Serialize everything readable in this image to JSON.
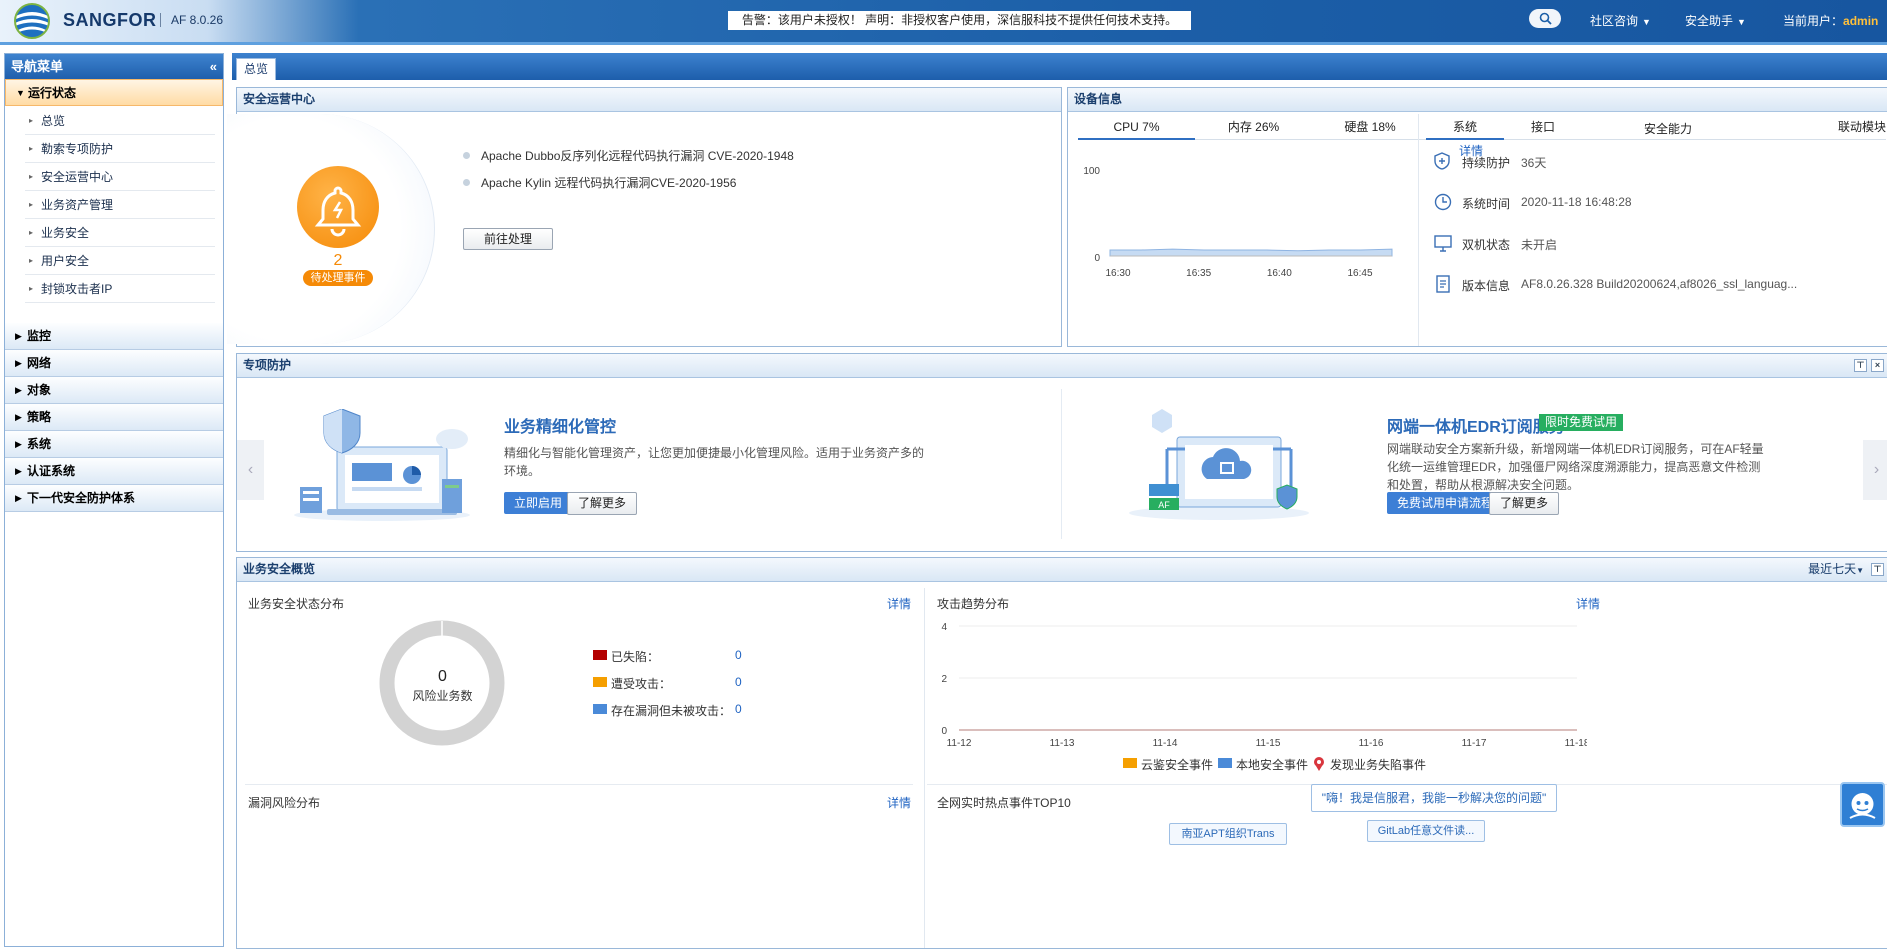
{
  "header": {
    "brand": "SANGFOR",
    "version": "AF 8.0.26",
    "notice": "告警：该用户未授权！   声明：非授权客户使用，深信服科技不提供任何技术支持。",
    "menu_community": "社区咨询",
    "menu_assistant": "安全助手",
    "user_label": "当前用户：",
    "user_name": "admin"
  },
  "sidebar": {
    "title": "导航菜单",
    "open_group": "运行状态",
    "items": [
      "总览",
      "勒索专项防护",
      "安全运营中心",
      "业务资产管理",
      "业务安全",
      "用户安全",
      "封锁攻击者IP"
    ],
    "groups": [
      "监控",
      "网络",
      "对象",
      "策略",
      "系统",
      "认证系统",
      "下一代安全防护体系"
    ]
  },
  "tabs": {
    "overview": "总览"
  },
  "soc": {
    "title": "安全运营中心",
    "pending_count": "2",
    "pending_label": "待处理事件",
    "events": [
      "Apache Dubbo反序列化远程代码执行漏洞 CVE-2020-1948",
      "Apache Kylin 远程代码执行漏洞CVE-2020-1956"
    ],
    "go_button": "前往处理"
  },
  "device": {
    "title": "设备信息",
    "metric_tabs": [
      "CPU 7%",
      "内存 26%",
      "硬盘 18%"
    ],
    "detail": "详情",
    "cpu_chart": {
      "y_ticks": [
        "100",
        "0"
      ],
      "x_ticks": [
        "16:30",
        "16:35",
        "16:40",
        "16:45"
      ]
    },
    "info_tabs": [
      "系统",
      "接口",
      "安全能力",
      "联动模块"
    ],
    "rows": [
      {
        "label": "持续防护",
        "value": "36天"
      },
      {
        "label": "系统时间",
        "value": "2020-11-18 16:48:28"
      },
      {
        "label": "双机状态",
        "value": "未开启"
      },
      {
        "label": "版本信息",
        "value": "AF8.0.26.328 Build20200624,af8026_ssl_languag..."
      }
    ]
  },
  "special": {
    "title": "专项防护",
    "card1": {
      "title": "业务精细化管控",
      "desc": "精细化与智能化管理资产，让您更加便捷最小化管理风险。适用于业务资产多的环境。",
      "primary": "立即启用",
      "secondary": "了解更多"
    },
    "card2": {
      "title": "网端一体机EDR订阅服务",
      "badge": "限时免费试用",
      "desc": "网端联动安全方案新升级，新增网端一体机EDR订阅服务，可在AF轻量化统一运维管理EDR，加强僵尸网络深度溯源能力，提高恶意文件检测和处置，帮助从根源解决安全问题。",
      "primary": "免费试用申请流程",
      "secondary": "了解更多",
      "af_tag": "AF"
    }
  },
  "biz": {
    "title": "业务安全概览",
    "range": "最近七天",
    "status_title": "业务安全状态分布",
    "detail": "详情",
    "donut_count": "0",
    "donut_label": "风险业务数",
    "legend": [
      {
        "label": "已失陷：",
        "value": "0",
        "color": "#b30000"
      },
      {
        "label": "遭受攻击：",
        "value": "0",
        "color": "#f59f00"
      },
      {
        "label": "存在漏洞但未被攻击：",
        "value": "0",
        "color": "#4a8ad8"
      }
    ],
    "trend_title": "攻击趋势分布",
    "vuln_title": "漏洞风险分布",
    "hot_title": "全网实时热点事件TOP10",
    "hot_items": [
      "南亚APT组织Trans",
      "GitLab任意文件读..."
    ],
    "bot_msg": "\"嗨！我是信服君，我能一秒解决您的问题\""
  },
  "chart_data": [
    {
      "type": "line",
      "title": "",
      "x": [
        "16:30",
        "16:35",
        "16:40",
        "16:45"
      ],
      "ylim": [
        0,
        100
      ],
      "series": [
        {
          "values": [
            7,
            7,
            8,
            7,
            7,
            7,
            6,
            7,
            7,
            8
          ]
        }
      ]
    },
    {
      "type": "pie",
      "title": "业务安全状态分布",
      "categories": [
        "已失陷",
        "遭受攻击",
        "存在漏洞但未被攻击"
      ],
      "values": [
        0,
        0,
        0
      ]
    },
    {
      "type": "line",
      "title": "攻击趋势分布",
      "x": [
        "11-12",
        "11-13",
        "11-14",
        "11-15",
        "11-16",
        "11-17",
        "11-18"
      ],
      "ylim": [
        0,
        4
      ],
      "y_ticks": [
        "4",
        "2",
        "0"
      ],
      "series": [
        {
          "name": "云鉴安全事件",
          "color": "#f59f00",
          "values": [
            0,
            0,
            0,
            0,
            0,
            0,
            0
          ]
        },
        {
          "name": "本地安全事件",
          "color": "#4a8ad8",
          "values": [
            0,
            0,
            0,
            0,
            0,
            0,
            0
          ]
        },
        {
          "name": "发现业务失陷事件",
          "color": "#d9363e",
          "values": [
            0,
            0,
            0,
            0,
            0,
            0,
            0
          ]
        }
      ]
    }
  ]
}
